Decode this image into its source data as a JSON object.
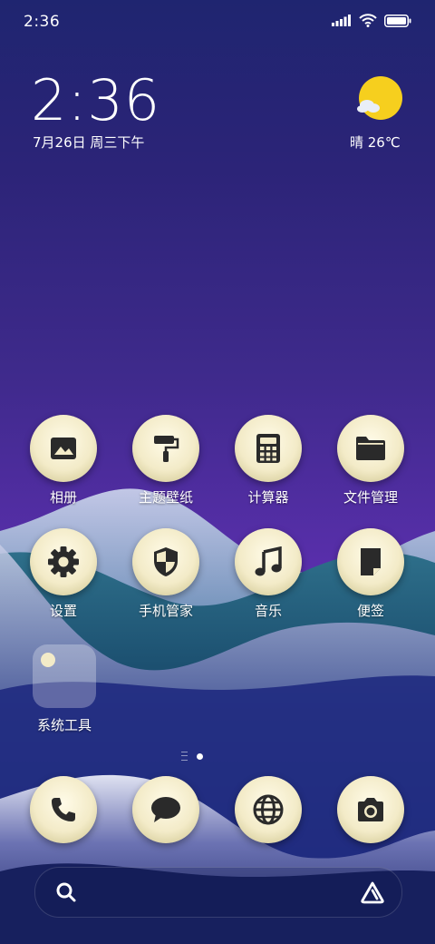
{
  "status_bar": {
    "time": "2:36",
    "icons": [
      "signal-icon",
      "wifi-icon",
      "battery-icon"
    ]
  },
  "clock_widget": {
    "time": "2:36",
    "date": "7月26日 周三下午"
  },
  "weather_widget": {
    "icon": "sun-cloud-icon",
    "text": "晴 26℃"
  },
  "apps_row1": [
    {
      "label": "相册",
      "icon": "gallery-icon"
    },
    {
      "label": "主题壁纸",
      "icon": "paint-roller-icon"
    },
    {
      "label": "计算器",
      "icon": "calculator-icon"
    },
    {
      "label": "文件管理",
      "icon": "folder-icon"
    }
  ],
  "apps_row2": [
    {
      "label": "设置",
      "icon": "gear-icon"
    },
    {
      "label": "手机管家",
      "icon": "shield-icon"
    },
    {
      "label": "音乐",
      "icon": "music-note-icon"
    },
    {
      "label": "便签",
      "icon": "note-icon"
    }
  ],
  "folder": {
    "label": "系统工具"
  },
  "dock": [
    {
      "name": "phone",
      "icon": "phone-icon"
    },
    {
      "name": "messages",
      "icon": "chat-bubble-icon"
    },
    {
      "name": "browser",
      "icon": "globe-icon"
    },
    {
      "name": "camera",
      "icon": "camera-icon"
    }
  ],
  "search": {
    "placeholder": ""
  },
  "colors": {
    "icon_bg": "#f3ebc8",
    "glyph": "#2a2a2a",
    "weather_sun": "#f6cf1e"
  }
}
